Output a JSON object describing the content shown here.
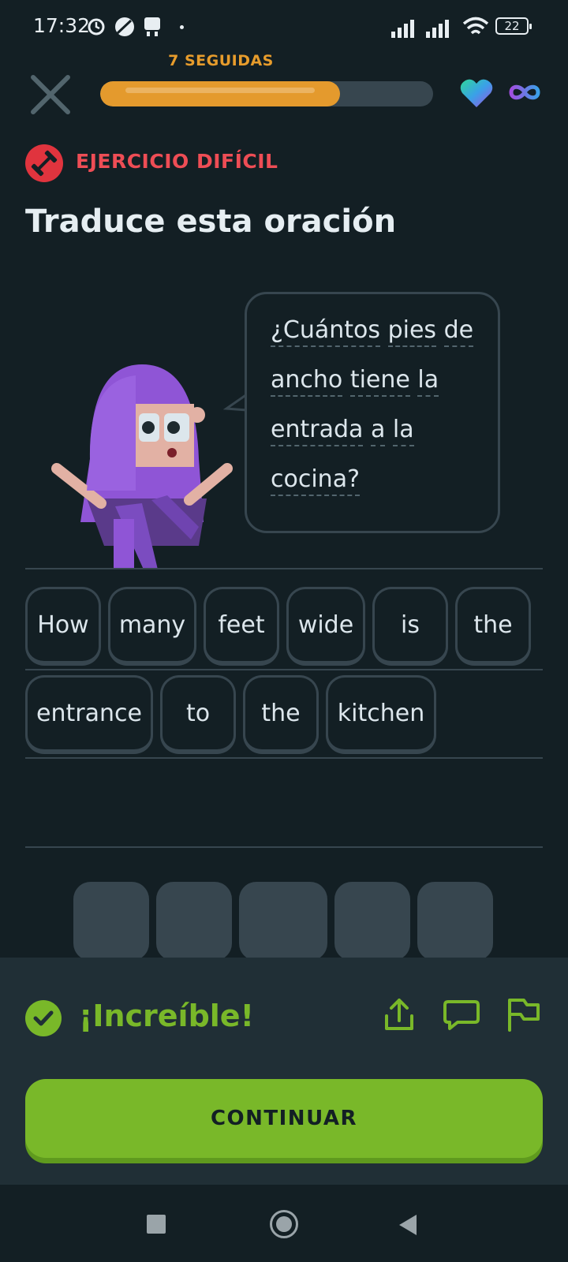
{
  "status_bar": {
    "time": "17:32",
    "battery": "22"
  },
  "lesson": {
    "streak_label": "7 SEGUIDAS",
    "progress": 0.72
  },
  "header": {
    "badge_label": "EJERCICIO DIFÍCIL",
    "title": "Traduce esta oración"
  },
  "prompt": {
    "lines": [
      [
        "¿Cuántos",
        "pies",
        "de"
      ],
      [
        "ancho",
        "tiene",
        "la"
      ],
      [
        "entrada",
        "a",
        "la"
      ],
      [
        "cocina?"
      ]
    ]
  },
  "answer": {
    "row1": [
      "How",
      "many",
      "feet",
      "wide",
      "is",
      "the"
    ],
    "row2": [
      "entrance",
      "to",
      "the",
      "kitchen"
    ]
  },
  "feedback": {
    "message": "¡Increíble!",
    "continue_label": "CONTINUAR"
  },
  "colors": {
    "background": "#131f24",
    "accent_green": "#79b829",
    "streak_orange": "#e49a2d",
    "hard_red": "#ee4d55",
    "chip_border": "#37464f"
  },
  "icons": [
    "close-icon",
    "hearts-icon",
    "infinity-icon",
    "dumbbell-icon",
    "share-icon",
    "comment-icon",
    "flag-icon",
    "check-icon"
  ]
}
